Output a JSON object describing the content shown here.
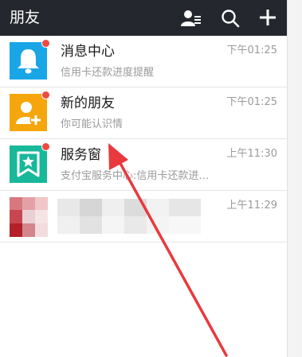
{
  "header": {
    "title": "朋友",
    "icons": [
      "contacts-icon",
      "search-icon",
      "plus-icon"
    ],
    "background": "#25272e"
  },
  "conversations": [
    {
      "name": "消息中心",
      "time": "下午01:25",
      "preview": "信用卡还款进度提醒",
      "icon": "bell-icon",
      "color": "#19a6e6",
      "unread": true
    },
    {
      "name": "新的朋友",
      "time": "下午01:25",
      "preview": "你可能认识情",
      "icon": "add-person-icon",
      "color": "#f5a60d",
      "unread": true
    },
    {
      "name": "服务窗",
      "time": "上午11:30",
      "preview": "支付宝服务中心:信用卡还款进…",
      "icon": "bookmark-star-icon",
      "color": "#18b89a",
      "unread": true
    },
    {
      "name": "",
      "time": "上午11:29",
      "preview": "",
      "icon": "avatar-blurred",
      "color": "#c0202a",
      "unread": false
    }
  ],
  "annotation": {
    "color": "#e8393f"
  }
}
